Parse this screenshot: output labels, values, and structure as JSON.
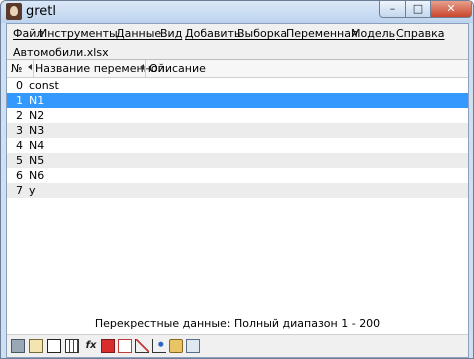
{
  "window": {
    "title": "gretl"
  },
  "menu": [
    "Файл",
    "Инструменты",
    "Данные",
    "Вид",
    "Добавить",
    "Выборка",
    "Переменная",
    "Модель",
    "Справка"
  ],
  "file_label": "Автомобили.xlsx",
  "table": {
    "headers": {
      "index": "№",
      "name": "Название переменной",
      "description": "Описание"
    },
    "rows": [
      {
        "index": "0",
        "name": "const"
      },
      {
        "index": "1",
        "name": "N1"
      },
      {
        "index": "2",
        "name": "N2"
      },
      {
        "index": "3",
        "name": "N3"
      },
      {
        "index": "4",
        "name": "N4"
      },
      {
        "index": "5",
        "name": "N5"
      },
      {
        "index": "6",
        "name": "N6"
      },
      {
        "index": "7",
        "name": "y"
      }
    ],
    "selected_row": 1
  },
  "status": "Перекрестные данные: Полный диапазон 1 - 200",
  "toolbar_icons": [
    "calculator-icon",
    "edit-icon",
    "terminal-icon",
    "grid-icon",
    "fx-icon",
    "pdf-icon",
    "graph-icon",
    "plot-icon",
    "chart-icon",
    "folder-icon",
    "window-icon"
  ],
  "colors": {
    "selection": "#3399ff",
    "alt_row": "#ececec"
  }
}
